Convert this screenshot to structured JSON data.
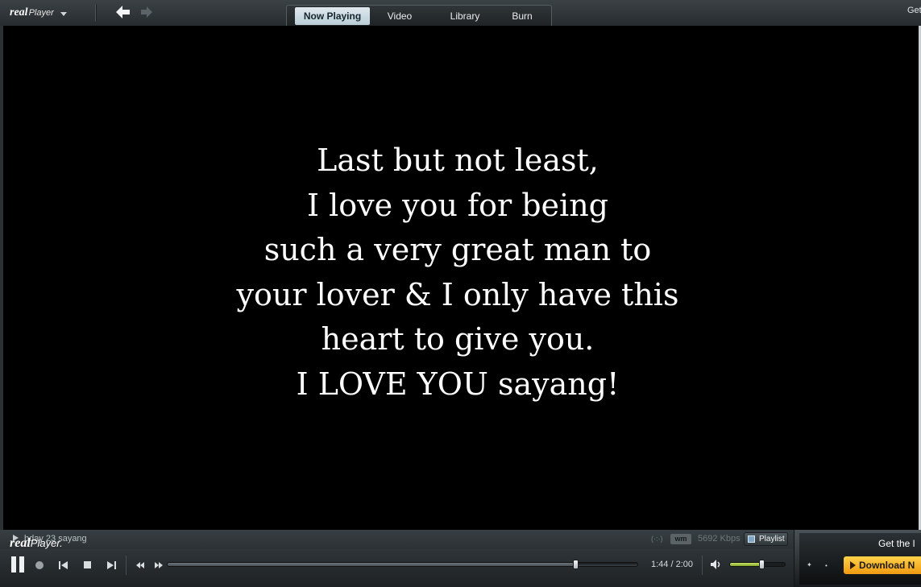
{
  "topbar": {
    "brand_mark": "real",
    "brand_sub": "Player",
    "tabs": [
      {
        "label": "Now Playing",
        "active": true
      },
      {
        "label": "Video",
        "active": false
      },
      {
        "label": "Library",
        "active": false
      },
      {
        "label": "Burn",
        "active": false
      }
    ],
    "right_text": "Get"
  },
  "video": {
    "lyrics": [
      "Last but not least,",
      "I love you for being",
      "such a very great man to",
      "your lover & I only have this",
      "heart to give you.",
      "I LOVE YOU sayang!"
    ]
  },
  "status": {
    "clip_title": "bday 23 sayang",
    "signal_icon": "(·:·)",
    "format_badge": "wm",
    "bitrate": "5692 Kbps",
    "playlist_label": "Playlist"
  },
  "controls": {
    "time": "1:44 / 2:00",
    "seek_fraction": 0.867,
    "volume_fraction": 0.57,
    "icons": [
      "pause-icon",
      "record-icon",
      "previous-icon",
      "stop-icon",
      "next-icon",
      "rewind-icon",
      "fast-forward-icon",
      "volume-icon"
    ]
  },
  "ad": {
    "brand_mark": "real",
    "brand_sub": "Player.",
    "tagline": "Get the l",
    "download_label": "Download N"
  },
  "colors": {
    "chrome_dark": "#262b2e",
    "tab_active": "#c9dbe4",
    "volume_green": "#a6c43c",
    "download_orange": "#f5b21f",
    "video_bg": "#000000"
  }
}
